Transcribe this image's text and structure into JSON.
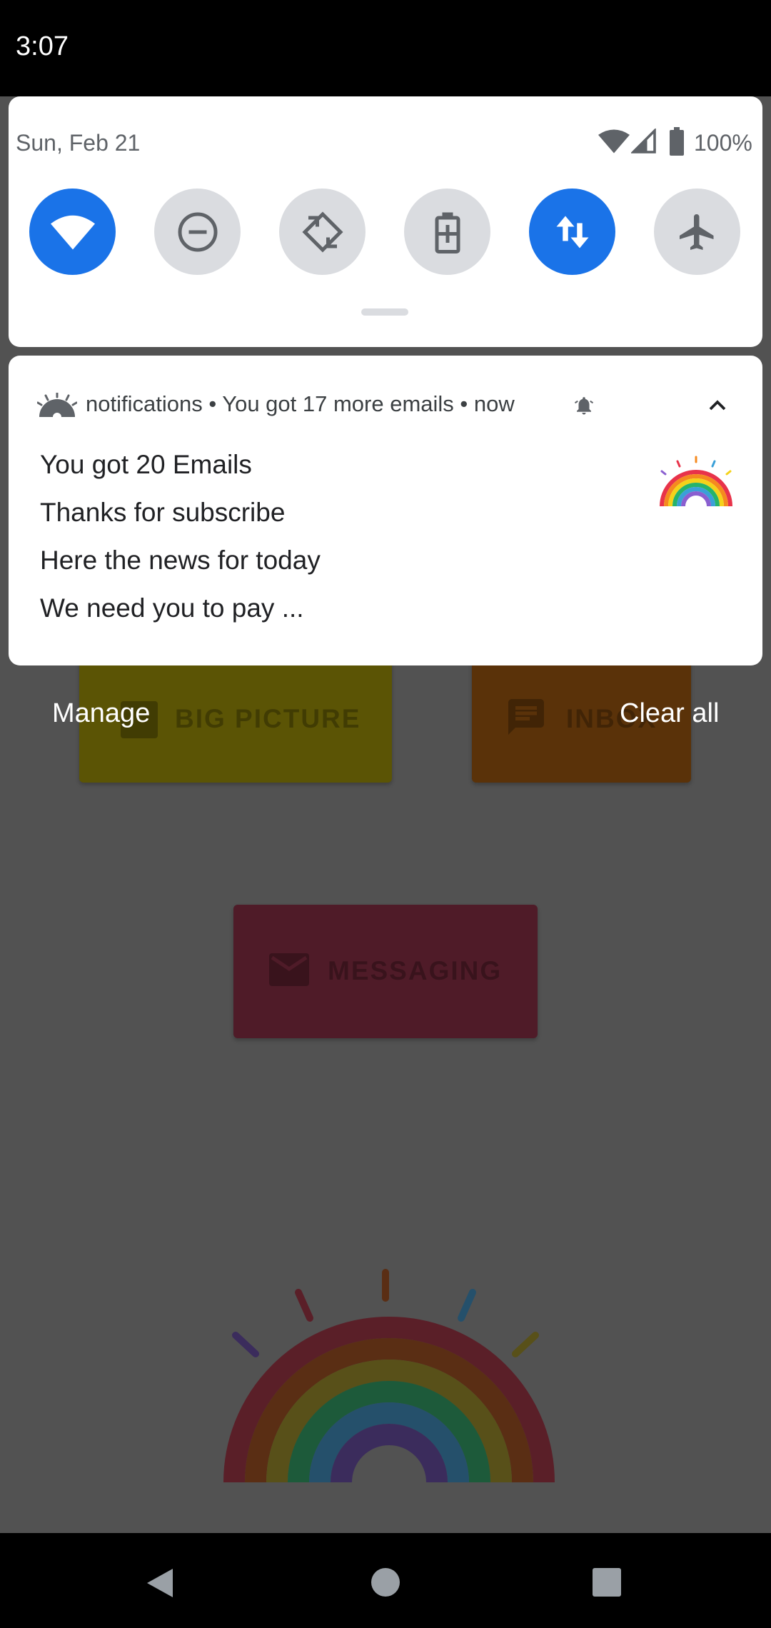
{
  "status_bar": {
    "time": "3:07"
  },
  "quick_settings": {
    "date": "Sun, Feb 21",
    "battery": "100%",
    "tiles": [
      {
        "name": "wifi",
        "on": true
      },
      {
        "name": "do-not-disturb",
        "on": false
      },
      {
        "name": "auto-rotate",
        "on": false
      },
      {
        "name": "battery-saver",
        "on": false
      },
      {
        "name": "mobile-data",
        "on": true
      },
      {
        "name": "airplane-mode",
        "on": false
      }
    ]
  },
  "notification": {
    "app_name": "notifications",
    "summary": "You got 17 more emails",
    "time": "now",
    "lines": [
      "You got 20 Emails",
      "Thanks for subscribe",
      "Here the news for today",
      "We need you to pay ..."
    ]
  },
  "shade_footer": {
    "manage": "Manage",
    "clear_all": "Clear all"
  },
  "background_app": {
    "big_picture": "BIG PICTURE",
    "inbox": "INBOX",
    "messaging": "MESSAGING"
  },
  "colors": {
    "accent": "#1a73e8",
    "scrim": "#525252",
    "big_picture_btn": "#5b5405",
    "inbox_btn": "#5a3209",
    "messaging_btn": "#4f1b28"
  }
}
